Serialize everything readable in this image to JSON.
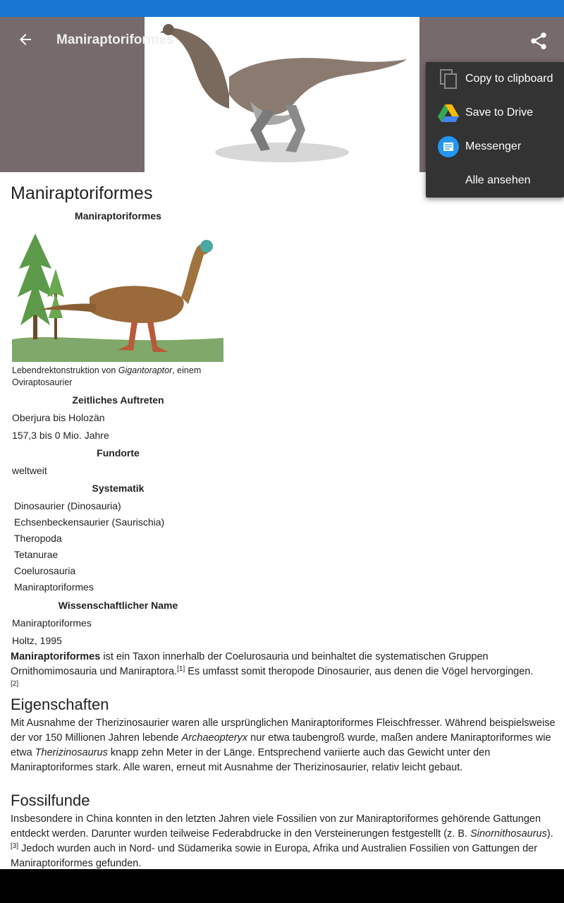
{
  "app_bar": {
    "title": "Maniraptoriformes"
  },
  "article": {
    "title": "Maniraptoriformes",
    "infobox": {
      "header": "Maniraptoriformes",
      "caption_pre": "Lebendrektonstruktion von ",
      "caption_em": "Gigantoraptor",
      "caption_post": ", einem Oviraptosaurier",
      "time_header": "Zeitliches Auftreten",
      "time_1": "Oberjura bis Holozän",
      "time_2": "157,3 bis 0 Mio. Jahre",
      "finds_header": "Fundorte",
      "finds_1": "weltweit",
      "sys_header": "Systematik",
      "systematics": [
        "Dinosaurier (Dinosauria)",
        "Echsenbeckensaurier (Saurischia)",
        "Theropoda",
        "Tetanurae",
        "Coelurosauria",
        "Maniraptoriformes"
      ],
      "sci_header": "Wissenschaftlicher Name",
      "sci_1": "Maniraptoriformes",
      "sci_2": "Holtz, 1995"
    },
    "intro": {
      "bold": "Maniraptoriformes",
      "t1": " ist ein Taxon innerhalb der Coelurosauria und beinhaltet die systematischen Gruppen Ornithomimosauria und Maniraptora.",
      "ref1": "[1]",
      "t2": " Es umfasst somit theropode Dinosaurier, aus denen die Vögel hervorgingen.",
      "ref2": "[2]"
    },
    "section1": {
      "title": "Eigenschaften",
      "t1": "Mit Ausnahme der Therizinosaurier waren alle ursprünglichen Maniraptoriformes Fleischfresser. Während beispielsweise der vor 150 Millionen Jahren lebende ",
      "em1": "Archaeopteryx",
      "t2": " nur etwa taubengroß wurde, maßen andere Maniraptoriformes wie etwa ",
      "em2": "Therizinosaurus",
      "t3": " knapp zehn Meter in der Länge. Entsprechend variierte auch das Gewicht unter den Maniraptoriformes stark. Alle waren, erneut mit Ausnahme der Therizinosaurier, relativ leicht gebaut."
    },
    "section2": {
      "title": "Fossilfunde",
      "t1": "Insbesondere in China konnten in den letzten Jahren viele Fossilien von zur Maniraptoriformes gehörende Gattungen entdeckt werden. Darunter wurden teilweise Federabdrucke in den Versteinerungen festgestellt (z. B. ",
      "em1": "Sinornithosaurus",
      "t2": ").",
      "ref3": "[3]",
      "t3": " Jedoch wurden auch in Nord- und Südamerika sowie in Europa, Afrika und Australien Fossilien von Gattungen der Maniraptoriformes gefunden."
    }
  },
  "share_menu": {
    "items": [
      {
        "label": "Copy to clipboard",
        "icon": "copy-icon"
      },
      {
        "label": "Save to Drive",
        "icon": "drive-icon"
      },
      {
        "label": "Messenger",
        "icon": "messenger-icon"
      },
      {
        "label": "Alle ansehen",
        "icon": ""
      }
    ]
  },
  "colors": {
    "status_bar": "#1976d2",
    "app_bar": "#776a6c",
    "menu_bg": "#333333"
  }
}
